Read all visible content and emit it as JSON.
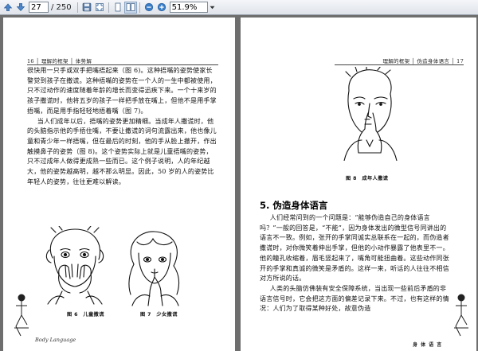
{
  "toolbar": {
    "current_page": "27",
    "total_pages": "/ 250",
    "zoom": "51.9%"
  },
  "left_page": {
    "running_head": "16 │ 理解的框架 │ 体势解",
    "paragraphs": [
      "很快用一只手或双手把嘴捂起来（图 6)。这种捂嘴的姿势使家长警觉到孩子在撒谎。这种捂嘴的姿势在一个人的一生中都被使用，只不过动作的速度随着年龄的增长而变得迅疾下来。一个十来岁的孩子撒谎时，他将五岁的孩子一样把手放在嘴上，但他不是用手掌捂嘴，而是用手指轻轻地捂着嘴（图 7)。",
      "当人们成年以后，捂嘴的姿势更加精细。当成年人撒谎时，他的头脑指示他的手捂住嘴，不要让撒谎的词句流露出来，他也像儿童和青少年一样捂嘴，但在最后的时刻，他的手从脸上撤开，作出触摸鼻子的姿势（图 8)。这个姿势实际上就是儿童捂嘴的姿势，只不过成年人做得更成熟一些而已。这个例子说明，人的年纪越大，他的姿势越高明，越不那么明显。因此，50 岁的人的姿势比年轻人的姿势，往往更难以解读。"
    ],
    "captions": [
      "图 6　儿童撒谎",
      "图 7　少女撒谎"
    ],
    "footer_script": "Body Language"
  },
  "right_page": {
    "running_head": "理解的框架 │ 伪造身体语言 │ 17",
    "caption": "图 8　成年人撒谎",
    "section_title": "5. 伪造身体语言",
    "paragraphs": [
      "人们经常问到的一个问题是：“能够伪造自己的身体语言吗？”一般的回答是，“不能”，因为身体发出的微型信号同讲出的语言不一致。例如，张开的手掌同诚实总联系在一起的，而伪造者撒谎时，对你微笑着伸出手掌，但他的小动作暴露了他表里不一。他的瞳孔收缩着，眉毛竖起来了，嘴角可能扭曲着。这些动作同张开的手掌和真诚的微笑是矛盾的。这样一来，听话的人往往不相信对方所说的话。",
      "人类的头脑仿佛装有安全保障系统，当出现一些前后矛盾的非语言信号时，它会把这方面的偏差记录下来。不过，也有这样的情况：人们为了取得某种好处，故意伪造"
    ],
    "footer_label": "身 体 语 言"
  }
}
